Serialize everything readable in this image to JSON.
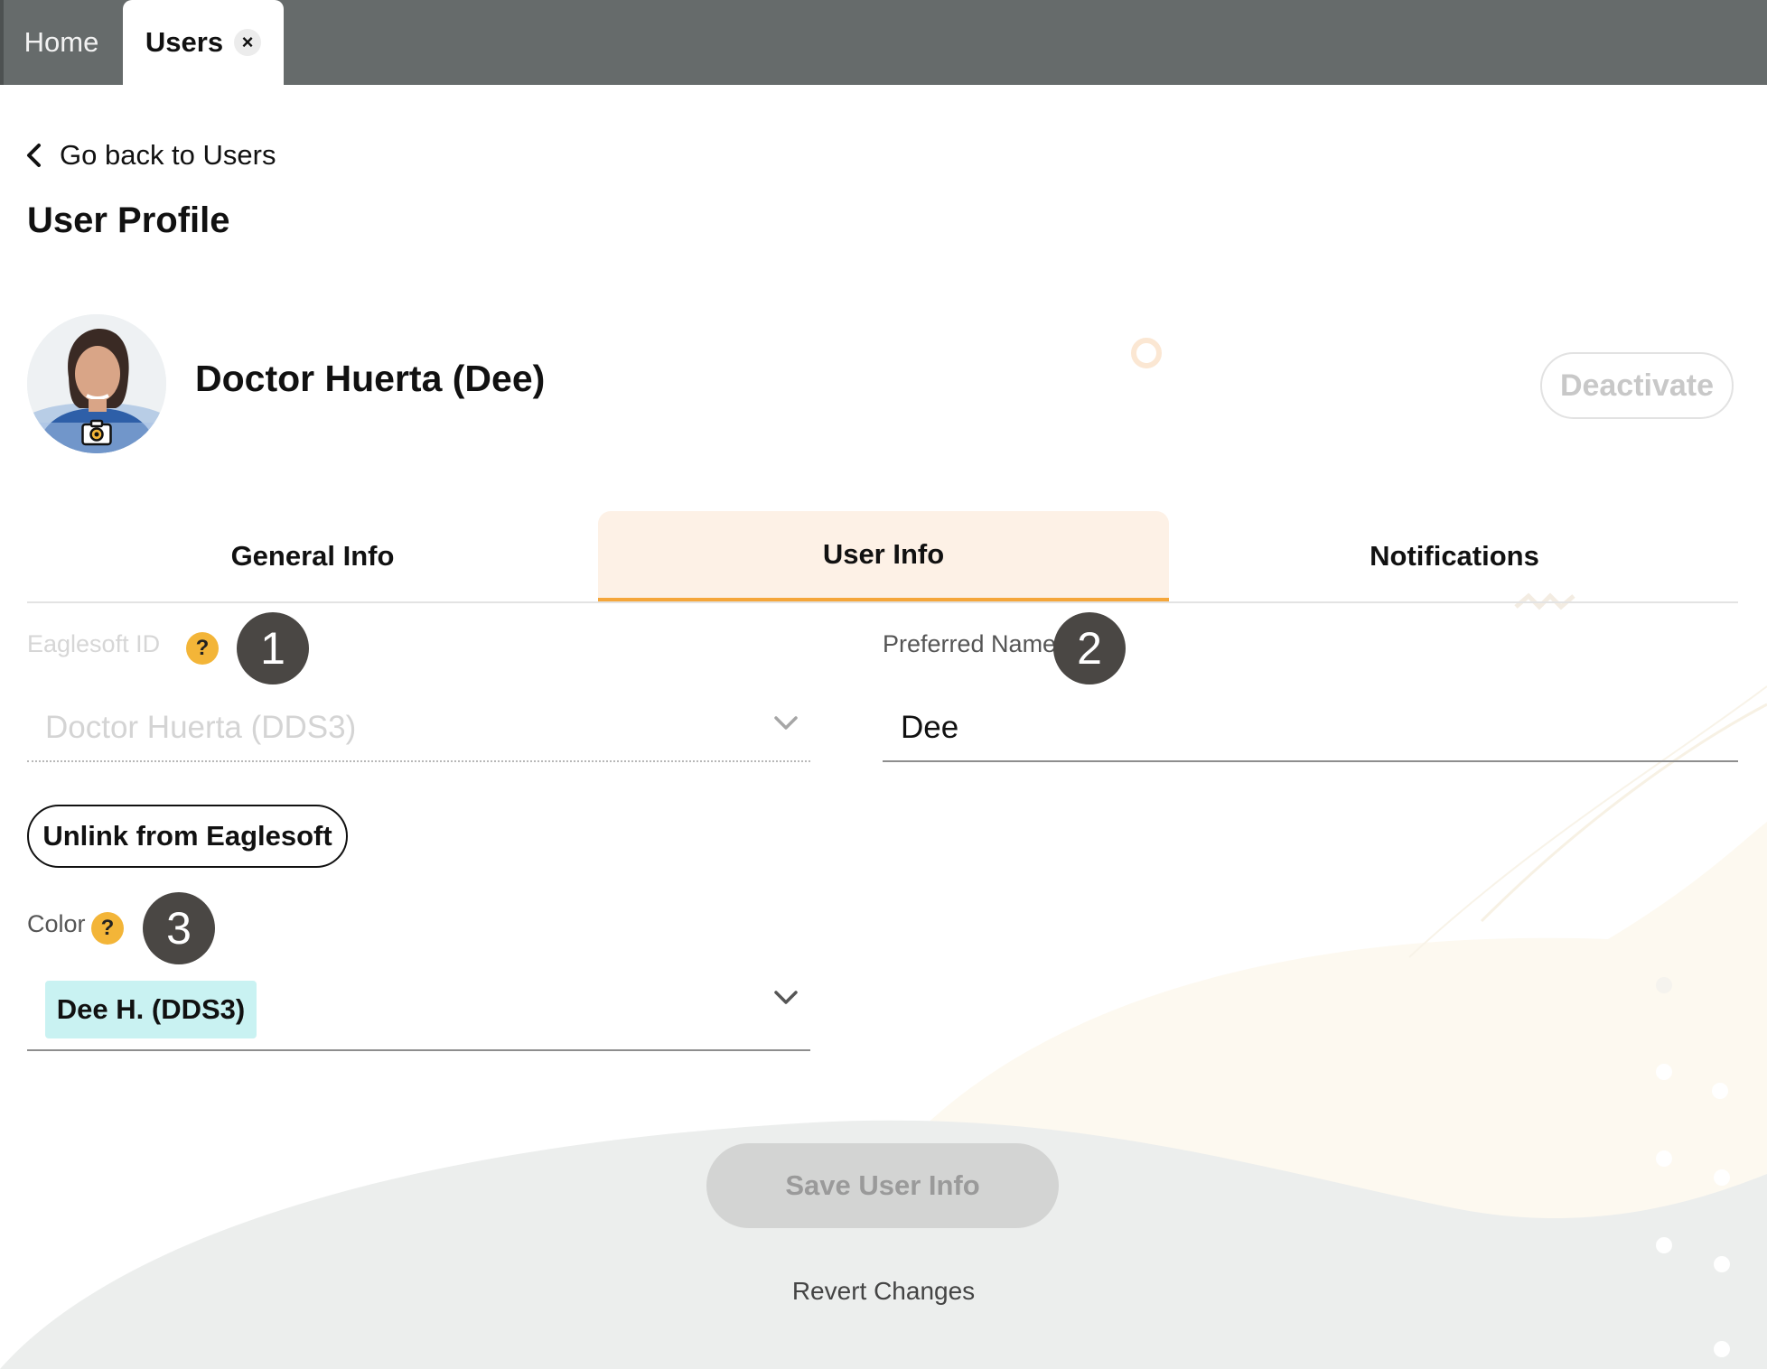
{
  "top_tabs": {
    "home_label": "Home",
    "users_label": "Users",
    "close_glyph": "×"
  },
  "nav": {
    "back_label": "Go back to Users"
  },
  "page": {
    "title": "User Profile"
  },
  "profile": {
    "name": "Doctor Huerta (Dee)",
    "deactivate_label": "Deactivate"
  },
  "section_tabs": [
    {
      "label": "General Info",
      "active": false
    },
    {
      "label": "User Info",
      "active": true
    },
    {
      "label": "Notifications",
      "active": false
    }
  ],
  "form": {
    "eaglesoft": {
      "label": "Eaglesoft ID",
      "help": "?",
      "step": "1",
      "value": "Doctor Huerta (DDS3)",
      "disabled": true
    },
    "preferred_name": {
      "label": "Preferred Name",
      "step": "2",
      "value": "Dee"
    },
    "unlink_label": "Unlink from Eaglesoft",
    "color": {
      "label": "Color",
      "help": "?",
      "step": "3",
      "value": "Dee H. (DDS3)",
      "chip_color": "#c9f2f2"
    }
  },
  "actions": {
    "save_label": "Save User Info",
    "save_enabled": false,
    "revert_label": "Revert Changes"
  },
  "colors": {
    "topbar": "#666b6b",
    "accent": "#f5a63a",
    "active_tab_bg": "#fdf1e6",
    "help_badge": "#f3b538",
    "step_badge": "#4a4744"
  },
  "icons": {
    "back": "chevron-left-icon",
    "camera": "camera-icon",
    "dropdown": "chevron-down-icon",
    "close": "close-icon",
    "help": "help-icon"
  }
}
